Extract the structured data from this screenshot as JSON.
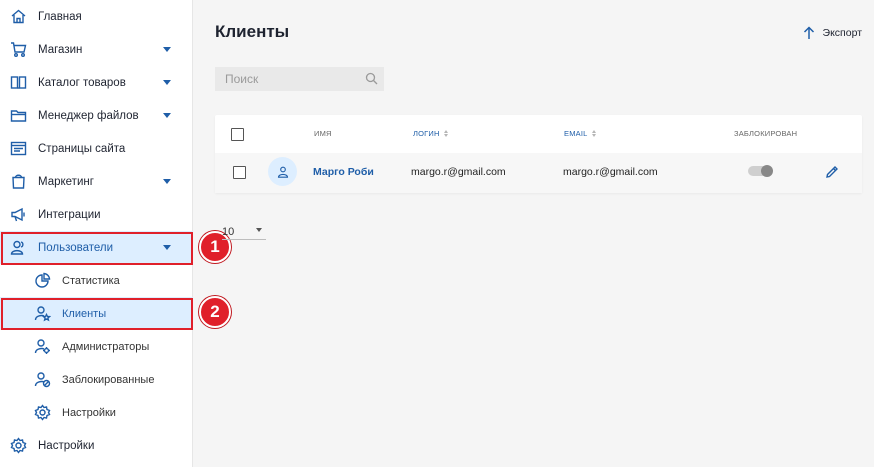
{
  "sidebar": {
    "items": [
      {
        "label": "Главная",
        "icon": "home-icon",
        "has_caret": false
      },
      {
        "label": "Магазин",
        "icon": "cart-icon",
        "has_caret": true
      },
      {
        "label": "Каталог товаров",
        "icon": "book-icon",
        "has_caret": true
      },
      {
        "label": "Менеджер файлов",
        "icon": "folder-icon",
        "has_caret": true
      },
      {
        "label": "Страницы сайта",
        "icon": "page-icon",
        "has_caret": false
      },
      {
        "label": "Маркетинг",
        "icon": "bag-icon",
        "has_caret": true
      },
      {
        "label": "Интеграции",
        "icon": "megaphone-icon",
        "has_caret": false
      },
      {
        "label": "Пользователи",
        "icon": "users-icon",
        "has_caret": true,
        "expanded": true
      },
      {
        "label": "Статистика",
        "icon": "pie-chart-icon",
        "sub": true
      },
      {
        "label": "Клиенты",
        "icon": "user-star-icon",
        "sub": true,
        "active": true
      },
      {
        "label": "Администраторы",
        "icon": "user-gear-icon",
        "sub": true
      },
      {
        "label": "Заблокированные",
        "icon": "user-block-icon",
        "sub": true
      },
      {
        "label": "Настройки",
        "icon": "gear-icon",
        "sub": true
      },
      {
        "label": "Настройки",
        "icon": "gear-icon",
        "has_caret": false
      }
    ]
  },
  "annotations": {
    "badge1": "1",
    "badge2": "2",
    "color": "#e0202a"
  },
  "header": {
    "title": "Клиенты",
    "export_label": "Экспорт"
  },
  "search": {
    "placeholder": "Поиск",
    "value": ""
  },
  "table": {
    "columns": {
      "name": "ИМЯ",
      "login": "ЛОГИН",
      "email": "EMAIL",
      "blocked": "ЗАБЛОКИРОВАН"
    },
    "rows": [
      {
        "name": "Марго Роби",
        "login": "margo.r@gmail.com",
        "email": "margo.r@gmail.com",
        "blocked": false
      }
    ]
  },
  "pagination": {
    "page_size": "10"
  },
  "colors": {
    "accent": "#1f5ea8",
    "active_bg": "#ddeeff",
    "background": "#f5f5f5"
  }
}
